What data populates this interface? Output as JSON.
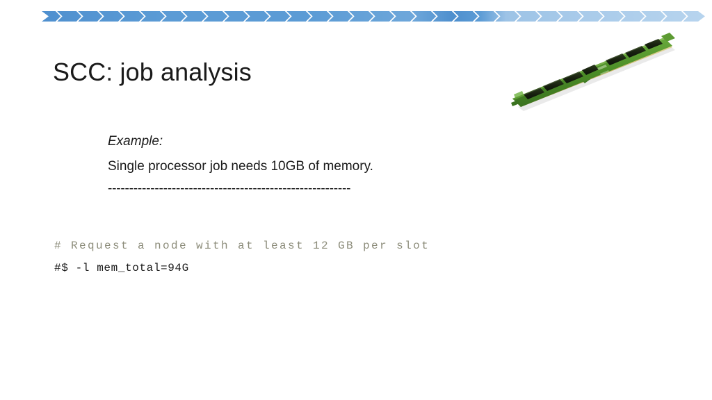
{
  "slide": {
    "title": "SCC: job analysis",
    "background_color": "#ffffff"
  },
  "banner": {
    "name": "chevron-banner",
    "start_color": "#5b9bd5",
    "end_color": "#b3cfea",
    "chevron_count": 31
  },
  "body": {
    "example_label": "Example:",
    "description": "Single processor job needs 10GB of memory.",
    "separator": "---------------------------------------------------------"
  },
  "code": {
    "comment_line": "# Request a node with at least 12 GB per slot",
    "command_line": "#$ -l mem_total=94G",
    "comment_color": "#8c8c7a",
    "command_color": "#1a1a1a"
  },
  "image": {
    "name": "ram-module-image",
    "alt": "Green DIMM memory module with eight dark memory chips and gold contact pins",
    "pcb_color": "#4a8c2a",
    "chip_color": "#1e2b14",
    "contact_color": "#c9b66a"
  }
}
